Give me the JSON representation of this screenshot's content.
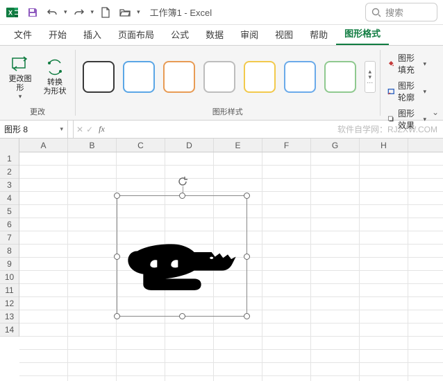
{
  "title": {
    "document": "工作簿1",
    "app": "Excel",
    "full": "工作簿1 - Excel"
  },
  "search": {
    "placeholder": "搜索"
  },
  "tabs": {
    "items": [
      {
        "label": "文件"
      },
      {
        "label": "开始"
      },
      {
        "label": "插入"
      },
      {
        "label": "页面布局"
      },
      {
        "label": "公式"
      },
      {
        "label": "数据"
      },
      {
        "label": "审阅"
      },
      {
        "label": "视图"
      },
      {
        "label": "帮助"
      },
      {
        "label": "图形格式"
      }
    ],
    "active_index": 9
  },
  "ribbon": {
    "change_group": {
      "label": "更改",
      "change_shape": "更改图\n形",
      "convert": "转换\n为形状"
    },
    "styles_group": {
      "label": "图形样式",
      "swatches": [
        {
          "border": "#3a3a3a"
        },
        {
          "border": "#5aa6e6"
        },
        {
          "border": "#e89b54"
        },
        {
          "border": "#bdbdbd"
        },
        {
          "border": "#f2c94c"
        },
        {
          "border": "#6aaaea"
        },
        {
          "border": "#8fc98f"
        }
      ]
    },
    "format_group": {
      "fill": "图形填充",
      "outline": "图形轮廓",
      "effects": "图形效果"
    }
  },
  "formula_bar": {
    "namebox": "图形 8",
    "fx": "fx",
    "watermark": "软件自学网：RJZXW.COM"
  },
  "grid": {
    "cols": [
      "A",
      "B",
      "C",
      "D",
      "E",
      "F",
      "G",
      "H"
    ],
    "rows": [
      "1",
      "2",
      "3",
      "4",
      "5",
      "6",
      "7",
      "8",
      "9",
      "10",
      "11",
      "12",
      "13",
      "14"
    ],
    "selected_col": "A",
    "selected_row": "1"
  },
  "shape": {
    "name": "crocodile-shape"
  }
}
